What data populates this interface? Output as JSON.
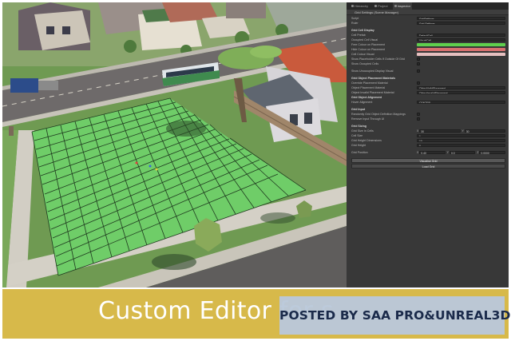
{
  "inspector": {
    "tabs": [
      {
        "label": "Hierarchy",
        "icon": "hierarchy-icon"
      },
      {
        "label": "Project",
        "icon": "folder-icon"
      },
      {
        "label": "Inspector",
        "icon": "info-icon"
      }
    ],
    "component_title": "Grid Settings (Scene Manager)",
    "rows": [
      {
        "label": "Script",
        "value": "GridSettings"
      },
      {
        "label": "Ruler",
        "value": "Grid Settings"
      },
      {
        "label": "Grid Cell Display",
        "section": true
      },
      {
        "label": "Cell Prefab",
        "value": "DefaultCell"
      },
      {
        "label": "Occupied Cell Visual",
        "value": "VisualCell"
      },
      {
        "label": "Free Colour on Placement",
        "color": "#5fcf4e"
      },
      {
        "label": "Hide Colour on Placement",
        "color": "#d87070"
      },
      {
        "label": "Cell Colour Visual",
        "color": "#e6c0c0"
      },
      {
        "label": "Show Placeholder Cells If Outside Of Grid",
        "toggle": true
      },
      {
        "label": "Show Occupied Cells",
        "toggle": true
      },
      {
        "label": "Show Unoccupied Display Visual",
        "toggle": true
      },
      {
        "label": "Grid Object Placement Materials",
        "section": true
      },
      {
        "label": "Override Placement Material",
        "toggle": true
      },
      {
        "label": "Object Placement Material",
        "value": "ObjectValidPlacement"
      },
      {
        "label": "Object Invalid Placement Material",
        "value": "ObjectInvalidPlacement"
      },
      {
        "label": "Grid Object Alignment",
        "section": true
      },
      {
        "label": "Hover Alignment",
        "value": "CENTER"
      },
      {
        "label": "Grid Input",
        "section": true
      },
      {
        "label": "Randomly Grid Object Definition Mappings",
        "toggle": true
      },
      {
        "label": "Remove Input Through UI",
        "toggle": true
      },
      {
        "label": "Grid Sizing",
        "section": true
      },
      {
        "label": "Grid Size In Cells",
        "x": "30",
        "y": "30"
      },
      {
        "label": "Cell Size",
        "value": "1"
      },
      {
        "label": "Grid Height Dimensions",
        "value": "10"
      },
      {
        "label": "Grid Height",
        "value": "0"
      },
      {
        "label": "Grid Position",
        "x": "0.40",
        "y": "0.0",
        "z": "0.0000"
      }
    ],
    "buttons": [
      {
        "label": "Visualise Grid"
      },
      {
        "label": "Load Grid"
      }
    ]
  },
  "banner": {
    "title": "Custom Editor for s",
    "watermark": "POSTED BY SAA PRO&UNREAL3D"
  }
}
